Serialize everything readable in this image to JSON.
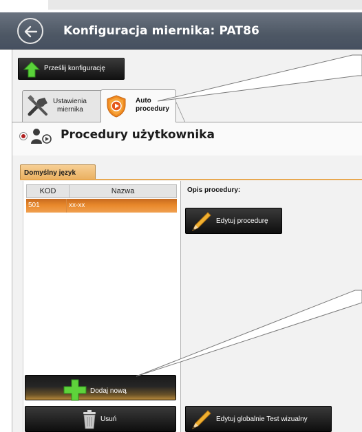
{
  "window": {
    "title": "Konfiguracja miernika: PAT86"
  },
  "toolbar": {
    "send_label": "Prześlij konfigurację"
  },
  "tabs": [
    {
      "label_line1": "Ustawienia",
      "label_line2": "miernika",
      "icon": "tools-icon",
      "selected": false
    },
    {
      "label_line1": "Auto",
      "label_line2": "procedury",
      "icon": "auto-procedure-shield-icon",
      "selected": true
    }
  ],
  "section": {
    "title": "Procedury użytkownika"
  },
  "language_tab": {
    "label": "Domyślny język"
  },
  "procedures_table": {
    "columns": [
      "KOD",
      "Nazwa"
    ],
    "rows": [
      {
        "code": "501",
        "name": "xx-xx",
        "selected": true
      }
    ]
  },
  "description": {
    "label": "Opis procedury:"
  },
  "buttons": {
    "edit_procedure": "Edytuj procedurę",
    "add_new": "Dodaj nową",
    "delete": "Usuń",
    "edit_global_visual": "Edytuj globalnie Test wizualny"
  },
  "colors": {
    "header_bg": "#4e5865",
    "accent_orange": "#e8882a",
    "add_green": "#4cbf2a",
    "button_dark": "#121212"
  }
}
